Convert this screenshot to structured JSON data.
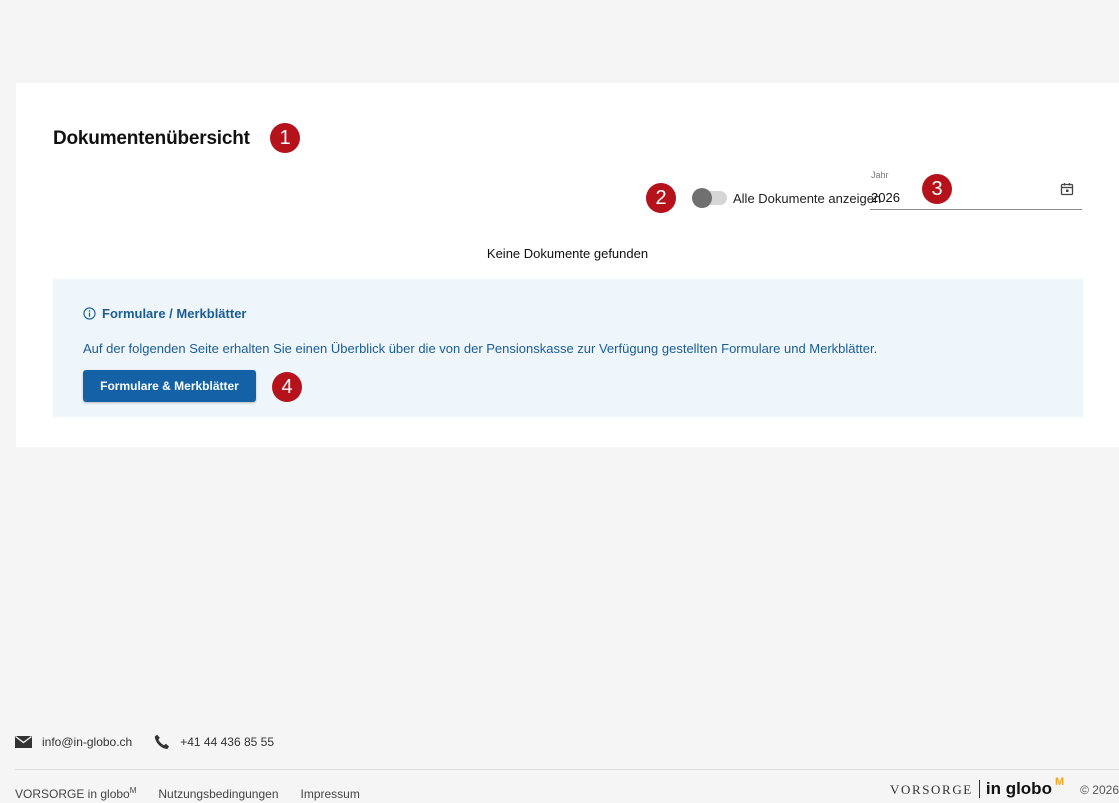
{
  "page": {
    "title": "Dokumentenübersicht",
    "empty_message": "Keine Dokumente gefunden"
  },
  "markers": [
    "1",
    "2",
    "3",
    "4"
  ],
  "filters": {
    "toggle_label": "Alle Dokumente anzeigen",
    "toggle_on": false,
    "year_caption": "Jahr",
    "year_value": "2026"
  },
  "info_box": {
    "heading": "Formulare / Merkblätter",
    "text": "Auf der folgenden Seite erhalten Sie einen Überblick über die von der Pensionskasse zur Verfügung gestellten Formulare und Merkblätter.",
    "button_label": "Formulare & Merkblätter"
  },
  "footer": {
    "email": "info@in-globo.ch",
    "phone": "+41 44 436 85 55",
    "link_vorsorge": "VORSORGE in globo",
    "link_vorsorge_sup": "M",
    "link_terms": "Nutzungsbedingungen",
    "link_imprint": "Impressum",
    "logo_part1": "VORSORGE",
    "logo_part2": "in globo",
    "logo_sup": "M",
    "copyright": "© 2026"
  },
  "colors": {
    "marker": "#b5121b",
    "primary": "#1462a5",
    "info_text": "#1b5c97",
    "info_background": "#eef6fc",
    "logo_accent": "#f5a623"
  },
  "icons": [
    "info-icon",
    "calendar-icon",
    "envelope-icon",
    "phone-icon"
  ]
}
